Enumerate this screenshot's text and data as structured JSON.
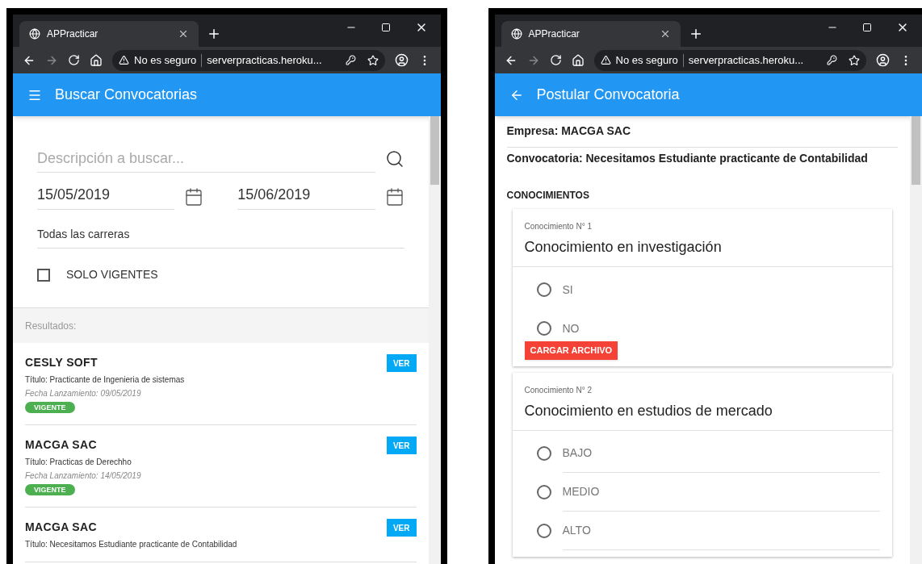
{
  "windows": [
    {
      "kind": "search",
      "tab_title": "APPracticar",
      "security": "No es seguro",
      "url": "serverpracticas.heroku...",
      "app_bar": {
        "kind": "menu",
        "title": "Buscar Convocatorias"
      },
      "search_field": {
        "placeholder": "Descripción a buscar..."
      },
      "date_from": "15/05/2019",
      "date_to": "15/06/2019",
      "career": "Todas las carreras",
      "only_active": {
        "label": "SOLO VIGENTES",
        "checked": false
      },
      "results_label": "Resultados:",
      "results": [
        {
          "company": "CESLY SOFT",
          "title": "Título: Practicante de Ingenieria de sistemas",
          "date": "Fecha Lanzamiento: 09/05/2019",
          "badge": "VIGENTE",
          "button": "VER"
        },
        {
          "company": "MACGA SAC",
          "title": "Título: Practicas de Derechho",
          "date": "Fecha Lanzamiento: 14/05/2019",
          "badge": "VIGENTE",
          "button": "VER"
        },
        {
          "company": "MACGA SAC",
          "title": "Título: Necesitamos Estudiante practicante de Contabilidad",
          "button": "VER"
        }
      ]
    },
    {
      "kind": "apply",
      "tab_title": "APPracticar",
      "security": "No es seguro",
      "url": "serverpracticas.heroku...",
      "app_bar": {
        "kind": "back",
        "title": "Postular Convocatoria"
      },
      "company": "Empresa: MACGA SAC",
      "call": "Convocatoria: Necesitamos Estudiante practicante de Contabilidad",
      "section": "CONOCIMIENTOS",
      "cards": [
        {
          "kind": "yes_no",
          "number": "Conocimiento N° 1",
          "title": "Conocimiento en investigación",
          "options": [
            {
              "label": "SI",
              "selected": false
            },
            {
              "label": "NO",
              "selected": false
            }
          ],
          "button": "CARGAR ARCHIVO"
        },
        {
          "kind": "level",
          "number": "Conocimiento N° 2",
          "title": "Conocimiento en estudios de mercado",
          "options": [
            {
              "label": "BAJO",
              "selected": false
            },
            {
              "label": "MEDIO",
              "selected": false
            },
            {
              "label": "ALTO",
              "selected": false
            }
          ]
        }
      ]
    }
  ]
}
